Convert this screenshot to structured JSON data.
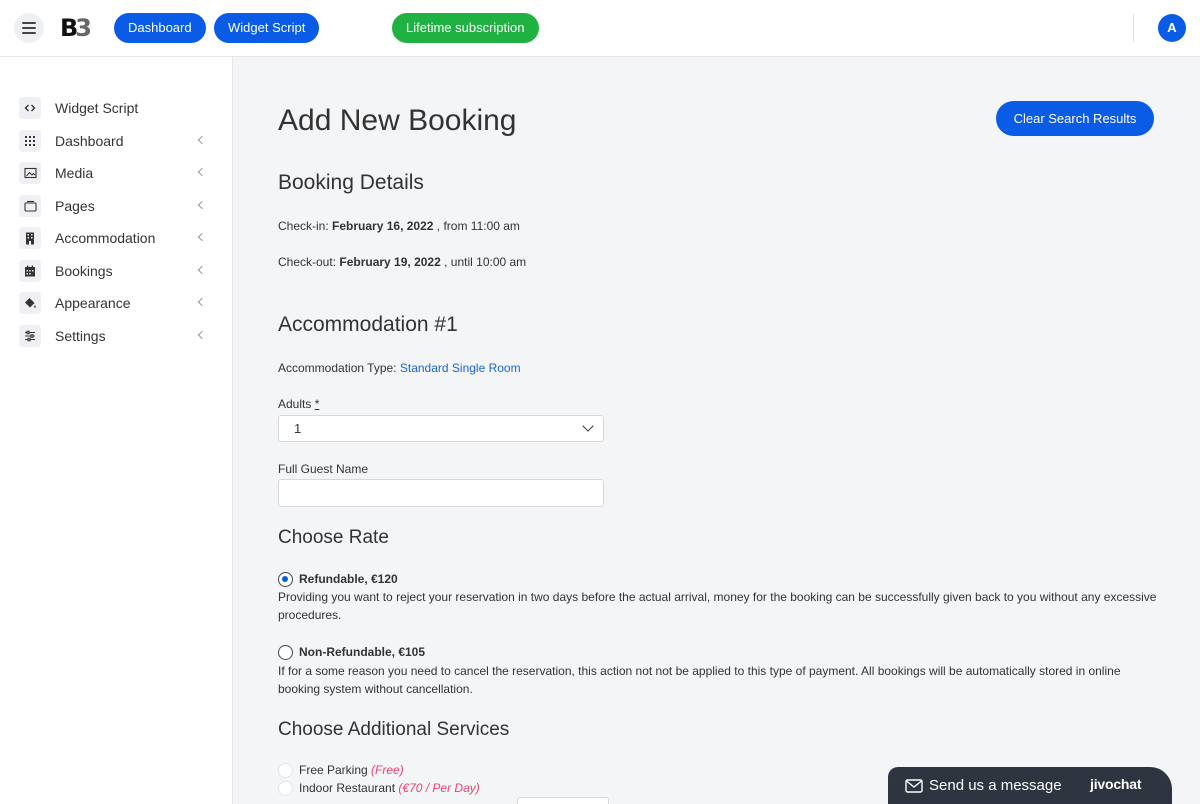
{
  "topbar": {
    "logo": {
      "b1": "B",
      "b2": "3"
    },
    "dashboard_label": "Dashboard",
    "widget_script_label": "Widget Script",
    "lifetime_label": "Lifetime subscription",
    "avatar_letter": "A"
  },
  "sidebar": {
    "items": [
      {
        "label": "Widget Script",
        "icon": "code-icon"
      },
      {
        "label": "Dashboard",
        "icon": "grid-icon"
      },
      {
        "label": "Media",
        "icon": "image-icon"
      },
      {
        "label": "Pages",
        "icon": "pages-icon"
      },
      {
        "label": "Accommodation",
        "icon": "building-icon"
      },
      {
        "label": "Bookings",
        "icon": "calendar-icon"
      },
      {
        "label": "Appearance",
        "icon": "paint-bucket-icon"
      },
      {
        "label": "Settings",
        "icon": "sliders-icon"
      }
    ]
  },
  "main": {
    "title": "Add New Booking",
    "clear_button": "Clear Search Results",
    "booking_details": {
      "heading": "Booking Details",
      "checkin_label": "Check-in:",
      "checkin_date": "February 16, 2022",
      "checkin_time": ", from 11:00 am",
      "checkout_label": "Check-out:",
      "checkout_date": "February 19, 2022",
      "checkout_time": ", until 10:00 am"
    },
    "accommodation": {
      "heading": "Accommodation #1",
      "type_label": "Accommodation Type:",
      "type_value": "Standard Single Room",
      "adults_label": "Adults",
      "adults_required": "*",
      "adults_value": "1",
      "guest_name_label": "Full Guest Name",
      "guest_name_value": ""
    },
    "rate": {
      "heading": "Choose Rate",
      "options": [
        {
          "label": "Refundable, €120",
          "description": "Providing you want to reject your reservation in two days before the actual arrival, money for the booking can be successfully given back to you without any excessive procedures.",
          "selected": true
        },
        {
          "label": "Non-Refundable, €105",
          "description": "If for a some reason you need to cancel the reservation, this action not not be applied to this type of payment. All bookings will be automatically stored in online booking system without cancellation.",
          "selected": false
        }
      ]
    },
    "services": {
      "heading": "Choose Additional Services",
      "items": [
        {
          "label": "Free Parking",
          "price": "(Free)"
        },
        {
          "label": "Indoor Restaurant",
          "price": "(€70 / Per Day)"
        }
      ]
    }
  },
  "chat": {
    "text": "Send us a message",
    "brand": "jivochat"
  },
  "colors": {
    "primary": "#0a5ce6",
    "success": "#1fb141",
    "price_pink": "#e8456b",
    "chat_bg": "#2e3440"
  }
}
